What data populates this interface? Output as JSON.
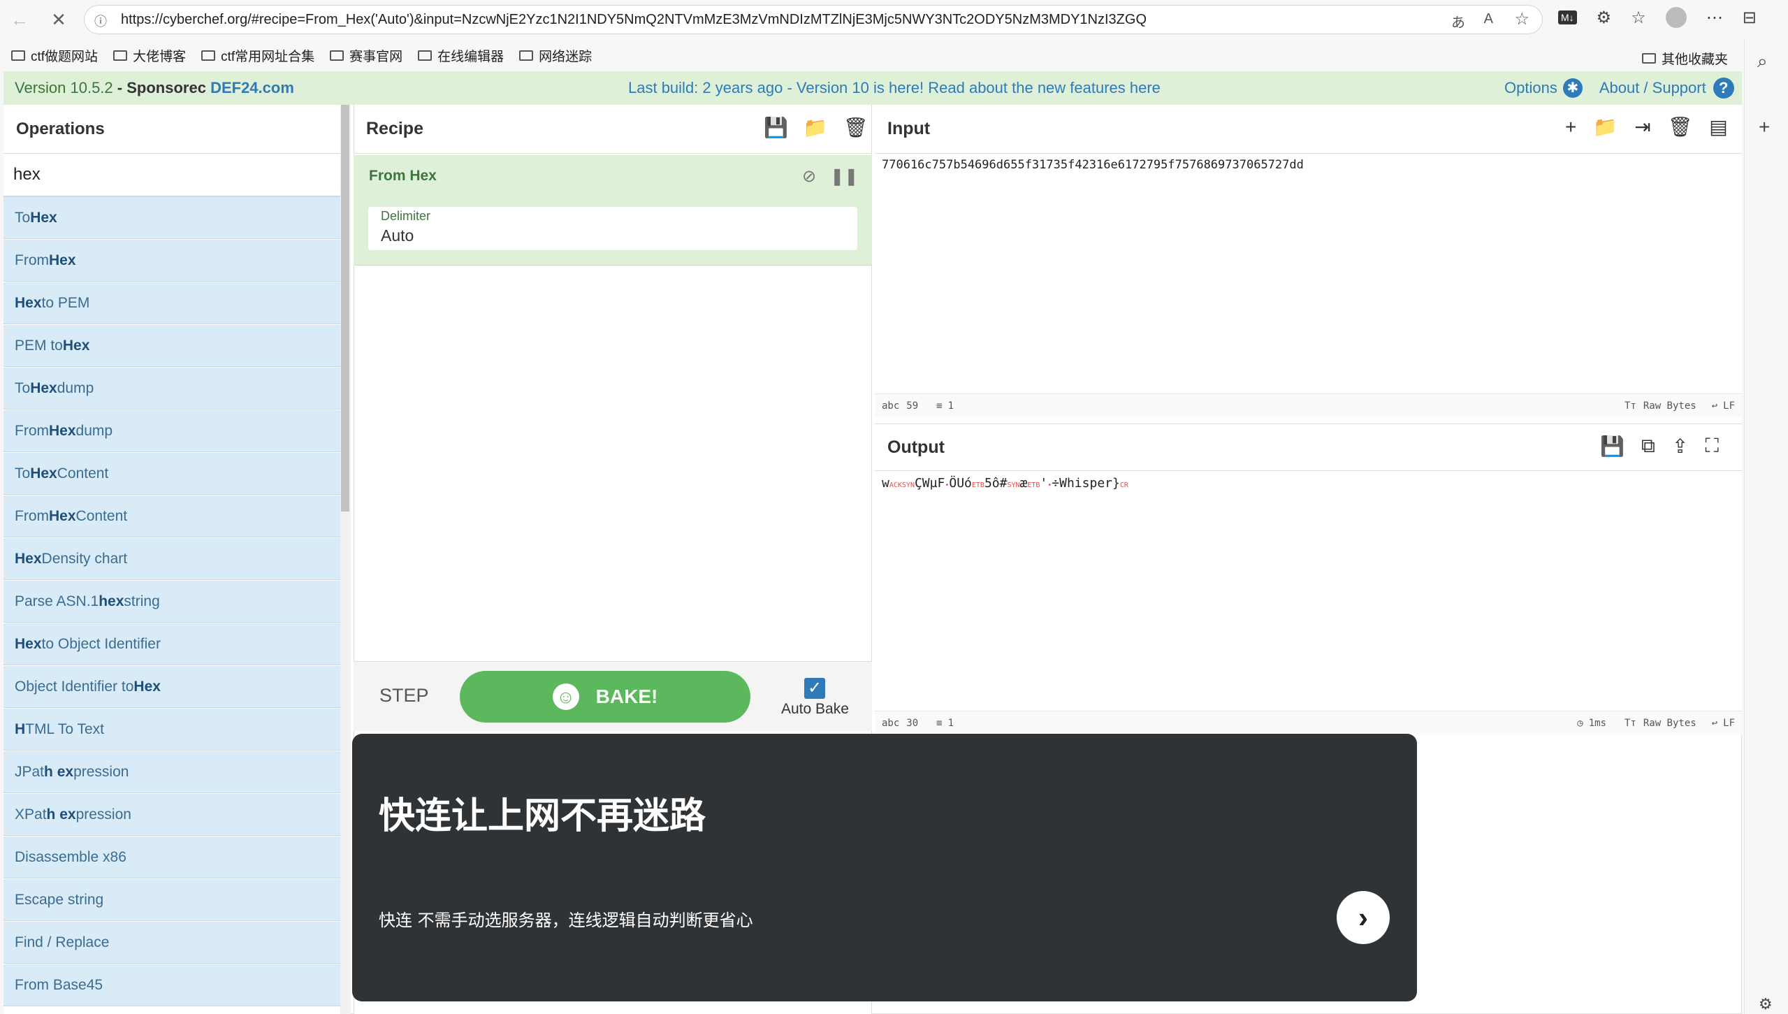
{
  "browser": {
    "url": "https://cyberchef.org/#recipe=From_Hex('Auto')&input=NzcwNjE2Yzc1N2I1NDY5NmQ2NTVmMzE3MzVmNDIzMTZlNjE3Mjc5NWY3NTc2ODY5NzM3MDY1NzI3ZGQ",
    "bookmarks": [
      "ctf做题网站",
      "大佬博客",
      "ctf常用网址合集",
      "赛事官网",
      "在线编辑器",
      "网络迷踪"
    ],
    "other_bookmarks": "其他收藏夹"
  },
  "banner": {
    "version": "Version 10.5.2",
    "sponsored": "- Sponsorec",
    "sponsor_link": "DEF24.com",
    "center": "Last build: 2 years ago - Version 10 is here! Read about the new features here",
    "options": "Options",
    "about": "About / Support"
  },
  "operations": {
    "title": "Operations",
    "search": "hex",
    "items": [
      {
        "pre": "To ",
        "hl": "Hex",
        "post": ""
      },
      {
        "pre": "From ",
        "hl": "Hex",
        "post": ""
      },
      {
        "pre": "",
        "hl": "Hex",
        "post": " to PEM"
      },
      {
        "pre": "PEM to ",
        "hl": "Hex",
        "post": ""
      },
      {
        "pre": "To ",
        "hl": "Hex",
        "post": "dump"
      },
      {
        "pre": "From ",
        "hl": "Hex",
        "post": "dump"
      },
      {
        "pre": "To ",
        "hl": "Hex",
        "post": " Content"
      },
      {
        "pre": "From ",
        "hl": "Hex",
        "post": " Content"
      },
      {
        "pre": "",
        "hl": "Hex",
        "post": " Density chart"
      },
      {
        "pre": "Parse ASN.1 ",
        "hl": "hex",
        "post": " string"
      },
      {
        "pre": "",
        "hl": "Hex",
        "post": " to Object Identifier"
      },
      {
        "pre": "Object Identifier to ",
        "hl": "Hex",
        "post": ""
      },
      {
        "pre": "",
        "hl": "H",
        "post": "TML To Text"
      },
      {
        "pre": "JPat",
        "hl": "h ex",
        "post": "pression"
      },
      {
        "pre": "XPat",
        "hl": "h ex",
        "post": "pression"
      },
      {
        "pre": "Disassemble x86",
        "hl": "",
        "post": ""
      },
      {
        "pre": "Escape string",
        "hl": "",
        "post": ""
      },
      {
        "pre": "Find / Replace",
        "hl": "",
        "post": ""
      },
      {
        "pre": "From Base45",
        "hl": "",
        "post": ""
      }
    ]
  },
  "recipe": {
    "title": "Recipe",
    "op_name": "From Hex",
    "delimiter_label": "Delimiter",
    "delimiter_value": "Auto",
    "step": "STEP",
    "bake": "BAKE!",
    "autobake": "Auto Bake"
  },
  "input": {
    "title": "Input",
    "text": "770616c757b54696d655f31735f42316e6172795f75768697370657 27dd",
    "text_exact": "770616c757b54696d655f31735f42316e6172795f7576869737065727dd",
    "length": "59",
    "lines": "1",
    "raw_bytes": "Raw Bytes",
    "eol": "LF"
  },
  "output": {
    "title": "Output",
    "length": "30",
    "lines": "1",
    "time": "1ms",
    "raw_bytes": "Raw Bytes",
    "eol": "LF"
  },
  "ad": {
    "title": "快连让上网不再迷路",
    "subtitle": "快连 不需手动选服务器，连线逻辑自动判断更省心"
  }
}
